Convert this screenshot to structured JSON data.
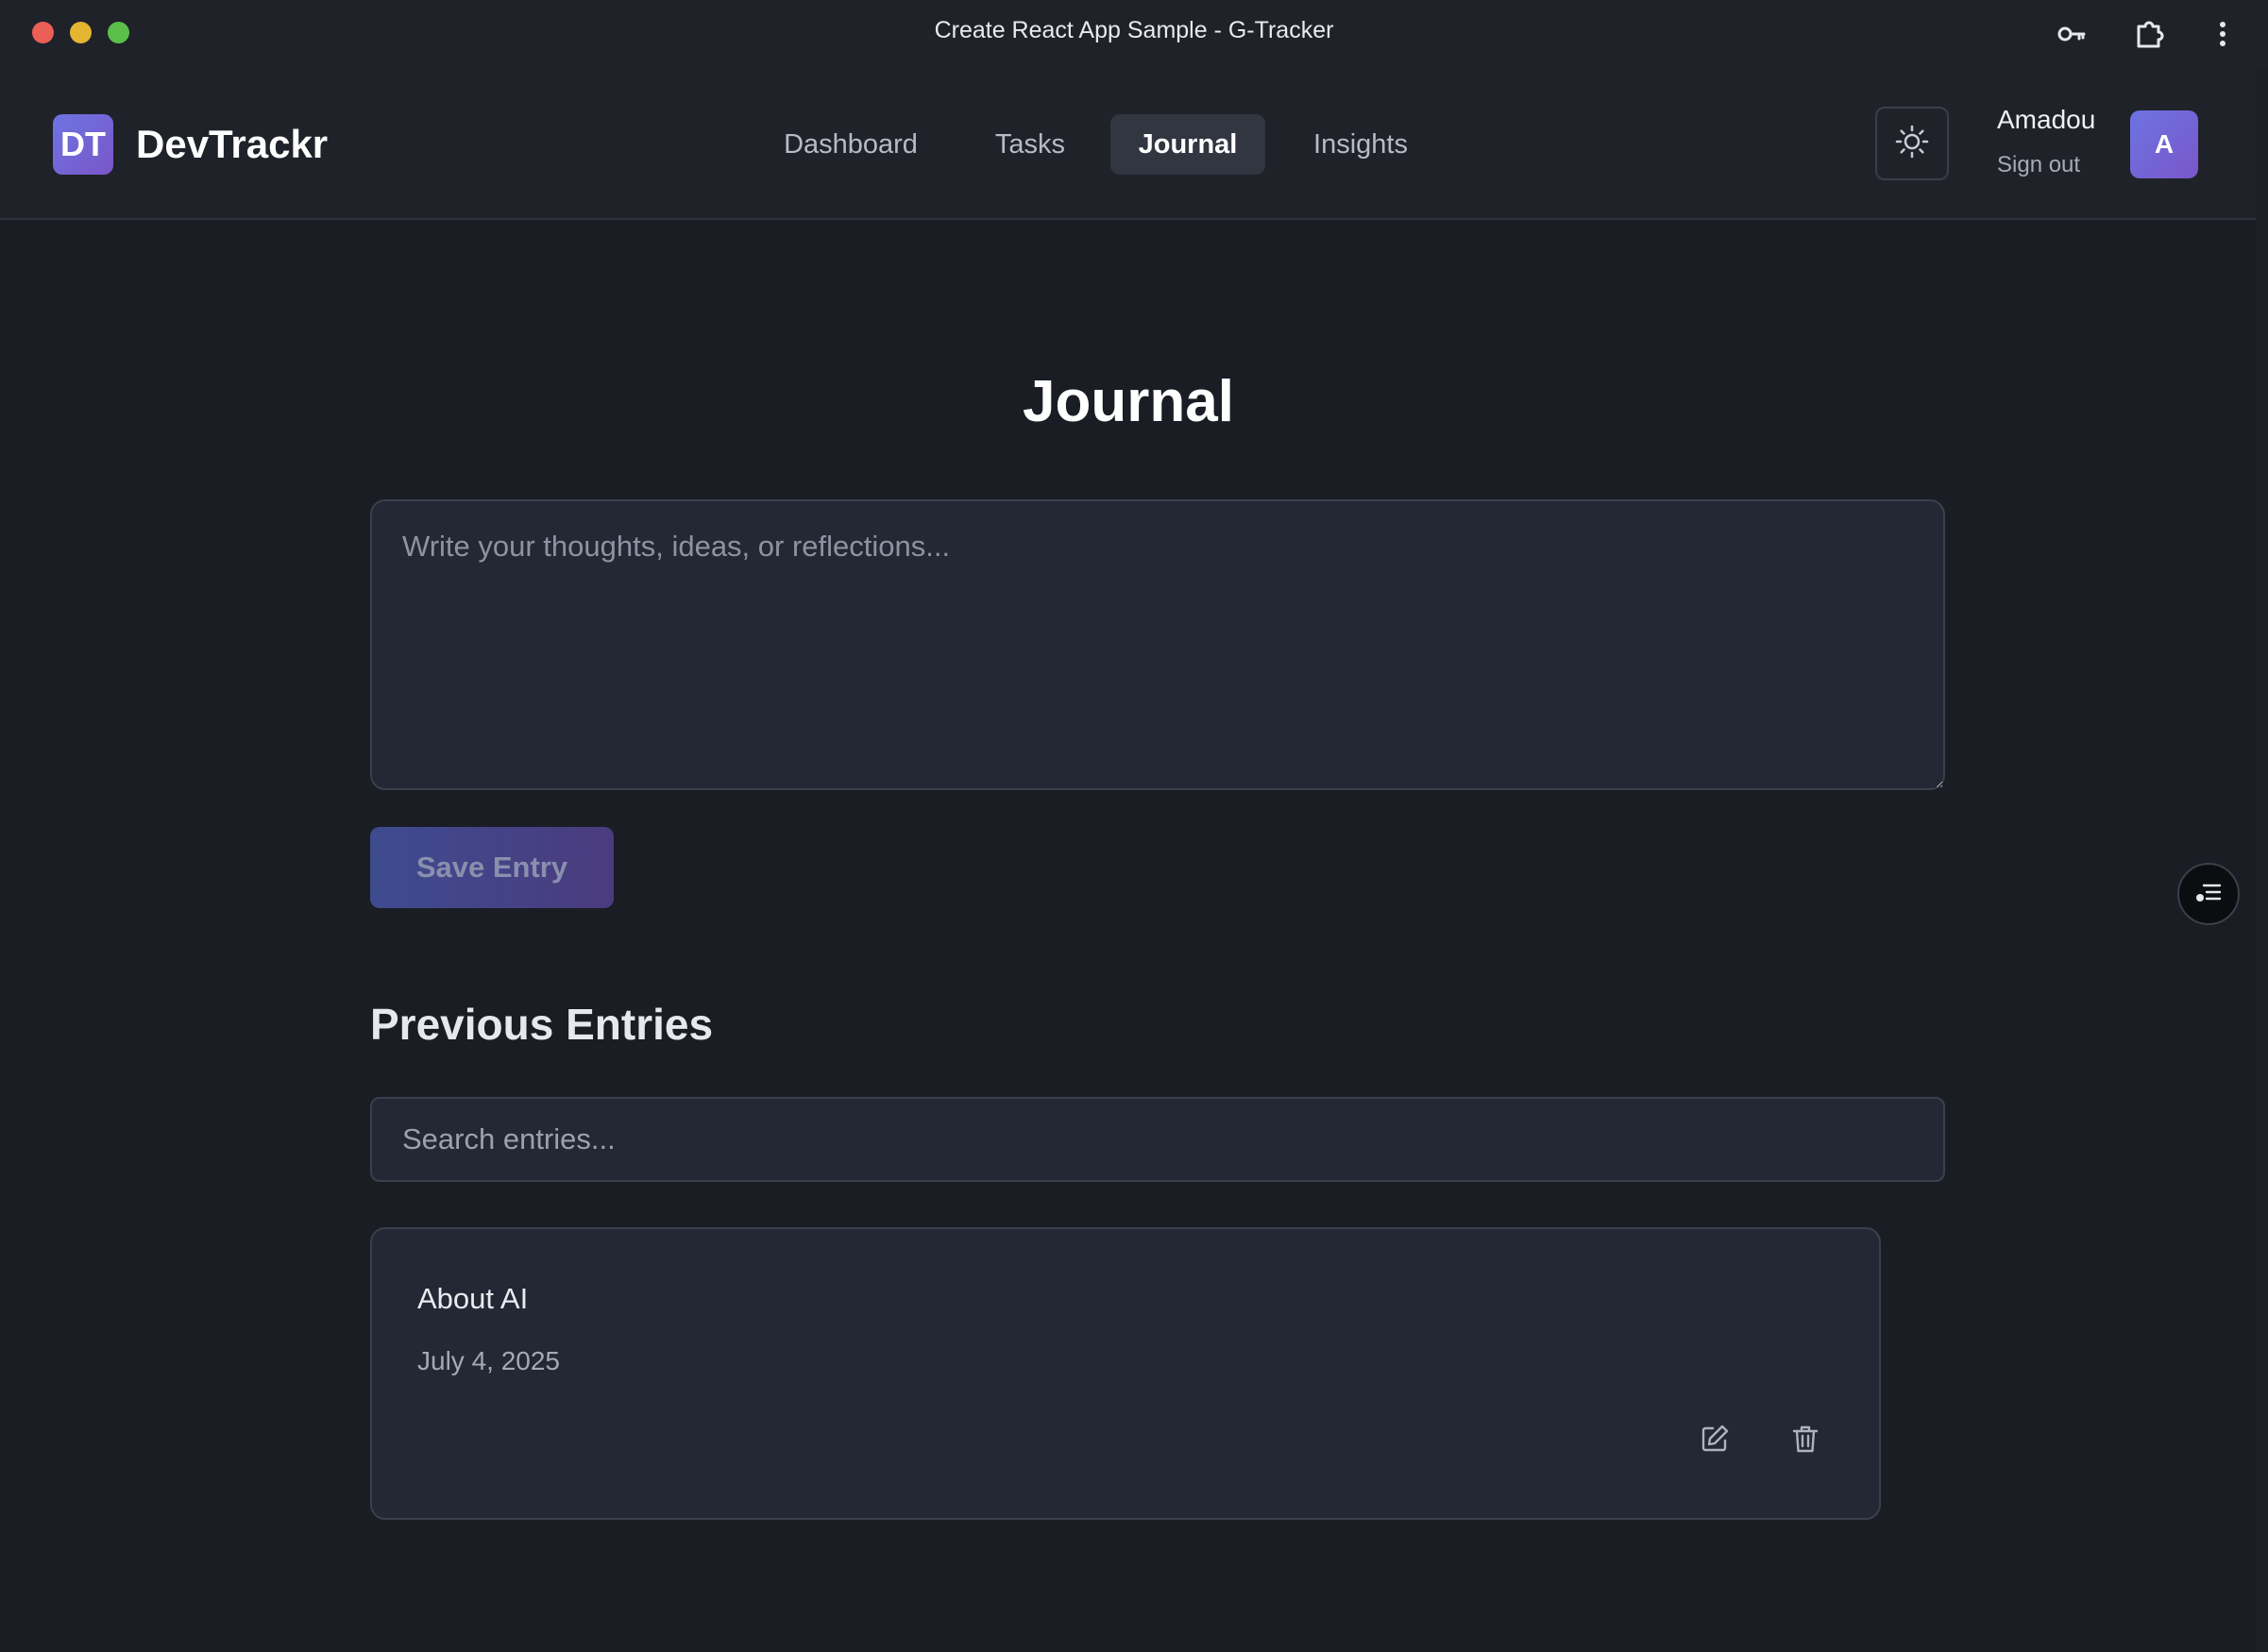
{
  "window": {
    "title": "Create React App Sample - G-Tracker"
  },
  "header": {
    "logo_text": "DT",
    "brand": "DevTrackr",
    "nav": [
      {
        "label": "Dashboard",
        "active": false
      },
      {
        "label": "Tasks",
        "active": false
      },
      {
        "label": "Journal",
        "active": true
      },
      {
        "label": "Insights",
        "active": false
      }
    ],
    "user": {
      "name": "Amadou",
      "sign_out": "Sign out",
      "avatar_initial": "A"
    },
    "icons": {
      "theme_toggle": "sun-icon"
    }
  },
  "main": {
    "title": "Journal",
    "editor": {
      "placeholder": "Write your thoughts, ideas, or reflections...",
      "value": ""
    },
    "save_button": "Save Entry",
    "previous_title": "Previous Entries",
    "search": {
      "placeholder": "Search entries...",
      "value": ""
    },
    "entries": [
      {
        "title": "About AI",
        "date": "July 4, 2025",
        "actions": [
          "edit-icon",
          "trash-icon"
        ]
      }
    ]
  },
  "colors": {
    "background": "#1a1d24",
    "header_bg": "#1f2229",
    "card_bg": "#232834",
    "accent_start": "#6d74e3",
    "accent_end": "#7a56c8",
    "active_nav_bg": "#323641"
  }
}
